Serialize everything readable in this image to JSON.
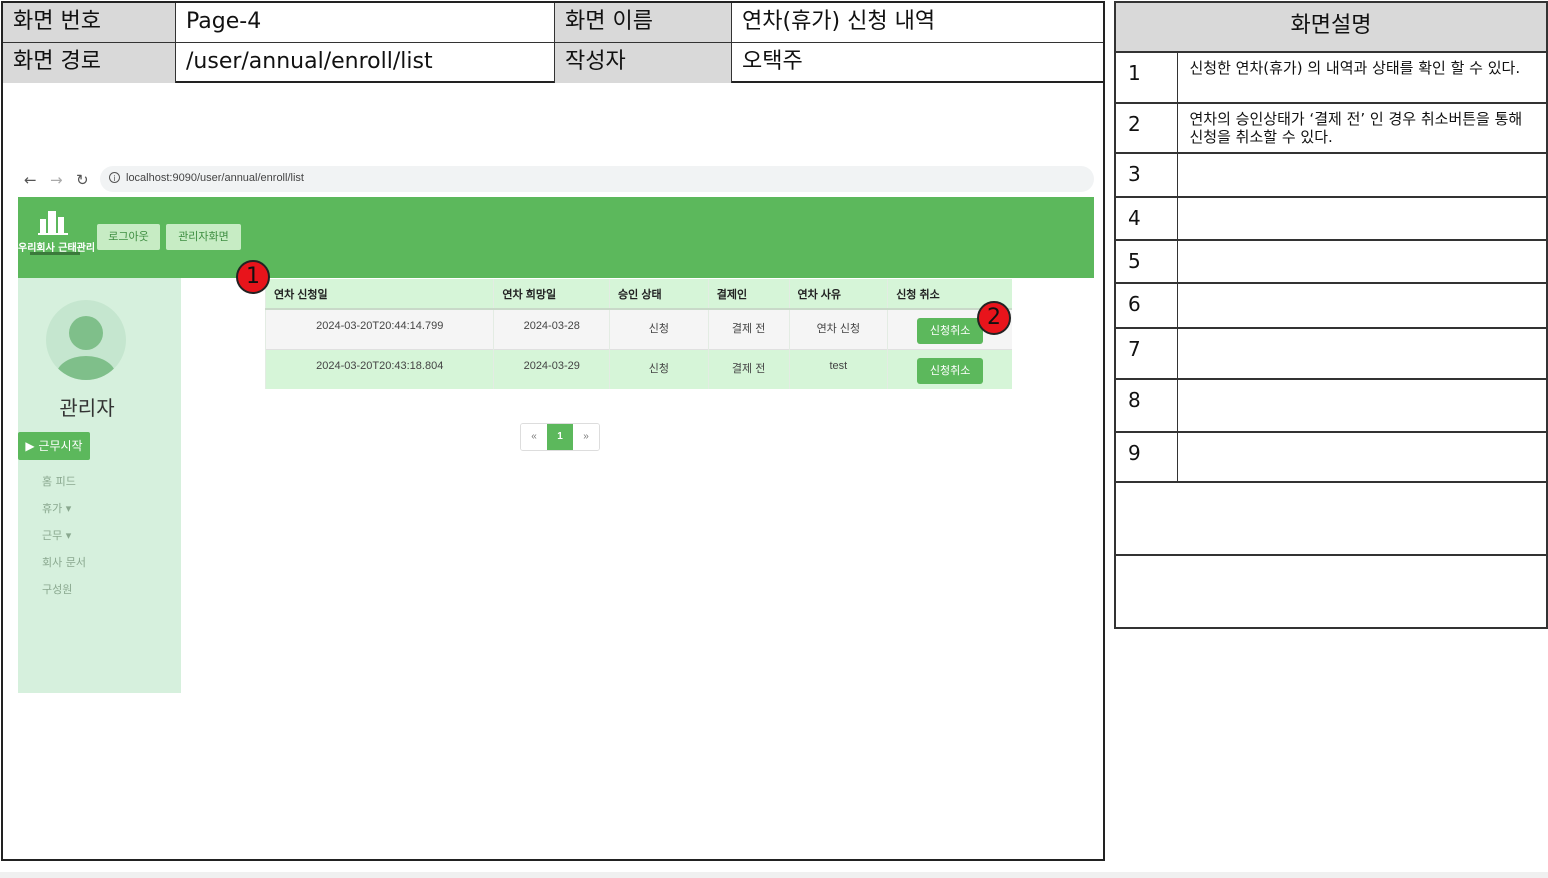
{
  "meta": {
    "screen_no_label": "화면 번호",
    "screen_no_value": "Page-4",
    "screen_name_label": "화면 이름",
    "screen_name_value": "연차(휴가) 신청 내역",
    "screen_path_label": "화면 경로",
    "screen_path_value": "/user/annual/enroll/list",
    "author_label": "작성자",
    "author_value": "오택주"
  },
  "browser": {
    "url": "localhost:9090/user/annual/enroll/list",
    "back_icon": "arrow-left-icon",
    "forward_icon": "arrow-right-icon",
    "reload_icon": "reload-icon"
  },
  "app": {
    "logo_text": "우리회사 근태관리",
    "logout_label": "로그아웃",
    "admin_label": "관리자화면",
    "accent": "#5cb85c",
    "sidebar": {
      "username": "관리자",
      "start_work_label": "▶ 근무시작",
      "menu": [
        "홈 피드",
        "휴가 ▾",
        "근무 ▾",
        "회사 문서",
        "구성원"
      ]
    },
    "table": {
      "columns": [
        "연차 신청일",
        "연차 희망일",
        "승인 상태",
        "결제인",
        "연차 사유",
        "신청 취소"
      ],
      "rows": [
        {
          "applied": "2024-03-20T20:44:14.799",
          "wish": "2024-03-28",
          "status": "신청",
          "approver": "결제 전",
          "reason": "연차 신청",
          "action": "신청취소"
        },
        {
          "applied": "2024-03-20T20:43:18.804",
          "wish": "2024-03-29",
          "status": "신청",
          "approver": "결제 전",
          "reason": "test",
          "action": "신청취소"
        }
      ]
    },
    "pager": {
      "prev": "«",
      "current": "1",
      "next": "»"
    }
  },
  "markers": [
    "1",
    "2"
  ],
  "description": {
    "title": "화면설명",
    "items": [
      {
        "no": "1",
        "text": "신청한 연차(휴가) 의 내역과 상태를 확인 할 수 있다."
      },
      {
        "no": "2",
        "text": "연차의 승인상태가 ‘결제 전’ 인 경우 취소버튼을 통해 신청을 취소할 수 있다."
      },
      {
        "no": "3",
        "text": ""
      },
      {
        "no": "4",
        "text": ""
      },
      {
        "no": "5",
        "text": ""
      },
      {
        "no": "6",
        "text": ""
      },
      {
        "no": "7",
        "text": ""
      },
      {
        "no": "8",
        "text": ""
      },
      {
        "no": "9",
        "text": ""
      }
    ]
  }
}
